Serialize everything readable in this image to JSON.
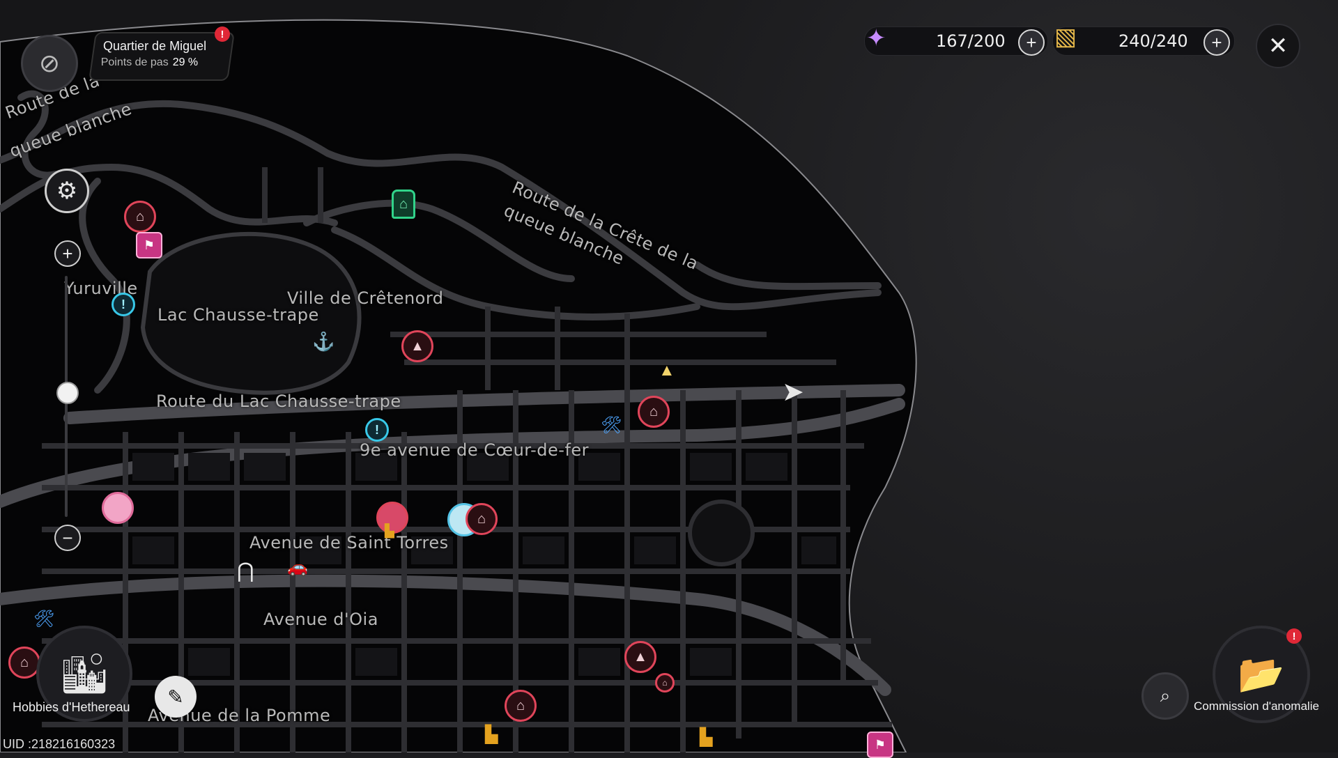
{
  "location": {
    "name": "Quartier de Miguel",
    "sub_label": "Points de pas",
    "percent": "29 %",
    "alert": "!"
  },
  "resources": [
    {
      "icon": "stamina-crystal-icon",
      "value": "167/200"
    },
    {
      "icon": "card-pack-icon",
      "value": "240/240"
    }
  ],
  "map_labels": {
    "road_crete_top": "Route de la",
    "road_crete_top2": "queue blanche",
    "road_crete_mid": "Route de la Crête de la",
    "road_crete_mid2": "queue blanche",
    "yuruville": "Yuruville",
    "cretenord": "Ville de Crêtenord",
    "lac": "Lac Chausse-trape",
    "route_lac": "Route du Lac Chausse-trape",
    "coeur_de_fer": "9e avenue de Cœur-de-fer",
    "saint_torres": "Avenue de Saint Torres",
    "oia": "Avenue d'Oia",
    "pomme": "Avenue de la Pomme"
  },
  "bottom_left": {
    "hobbies_label": "Hobbies d'Hethereau",
    "uid": "UID :218216160323"
  },
  "bottom_right": {
    "commission_label": "Commission d'anomalie",
    "alert": "!"
  },
  "colors": {
    "alert_red": "#e02837",
    "marker_red": "#e0455a",
    "marker_cyan": "#38c8e8",
    "marker_pink": "#c83583",
    "marker_green": "#31d38a",
    "marker_blue": "#4fa6ff",
    "marker_gold": "#e4a21f"
  },
  "zoom_level": 0.55
}
